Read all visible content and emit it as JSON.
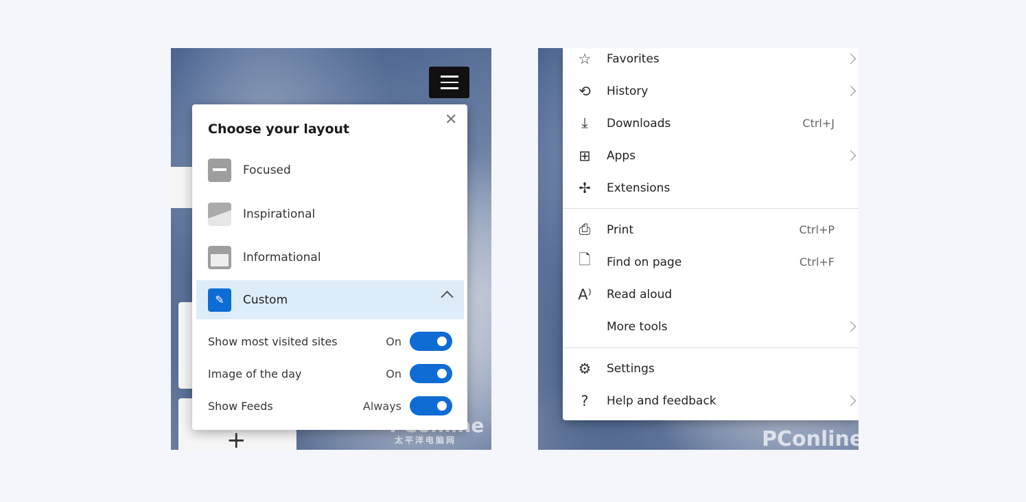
{
  "layout_dialog": {
    "title": "Choose your layout",
    "close_icon": "close-icon",
    "options": [
      {
        "label": "Focused",
        "icon": "focused-layout-icon"
      },
      {
        "label": "Inspirational",
        "icon": "inspirational-layout-icon"
      },
      {
        "label": "Informational",
        "icon": "informational-layout-icon"
      },
      {
        "label": "Custom",
        "icon": "pencil-icon",
        "selected": true,
        "expanded": true
      }
    ],
    "toggles": [
      {
        "label": "Show most visited sites",
        "state": "On",
        "on": true
      },
      {
        "label": "Image of the day",
        "state": "On",
        "on": true
      },
      {
        "label": "Show Feeds",
        "state": "Always",
        "on": true
      }
    ]
  },
  "menu": {
    "items": [
      {
        "label": "Favorites",
        "icon": "star-icon",
        "submenu": true
      },
      {
        "label": "History",
        "icon": "history-icon",
        "submenu": true
      },
      {
        "label": "Downloads",
        "icon": "download-icon",
        "shortcut": "Ctrl+J"
      },
      {
        "label": "Apps",
        "icon": "apps-icon",
        "submenu": true
      },
      {
        "label": "Extensions",
        "icon": "puzzle-icon"
      },
      {
        "label": "Print",
        "icon": "printer-icon",
        "shortcut": "Ctrl+P"
      },
      {
        "label": "Find on page",
        "icon": "find-icon",
        "shortcut": "Ctrl+F"
      },
      {
        "label": "Read aloud",
        "icon": "read-aloud-icon"
      },
      {
        "label": "More tools",
        "icon": "",
        "submenu": true
      },
      {
        "label": "Settings",
        "icon": "gear-icon"
      },
      {
        "label": "Help and feedback",
        "icon": "help-icon",
        "submenu": true
      }
    ]
  },
  "watermark": {
    "brand": "PConline",
    "subtitle": "太平洋电脑网"
  },
  "colors": {
    "accent": "#0f6cd4",
    "selected_bg": "#ddecf9"
  }
}
